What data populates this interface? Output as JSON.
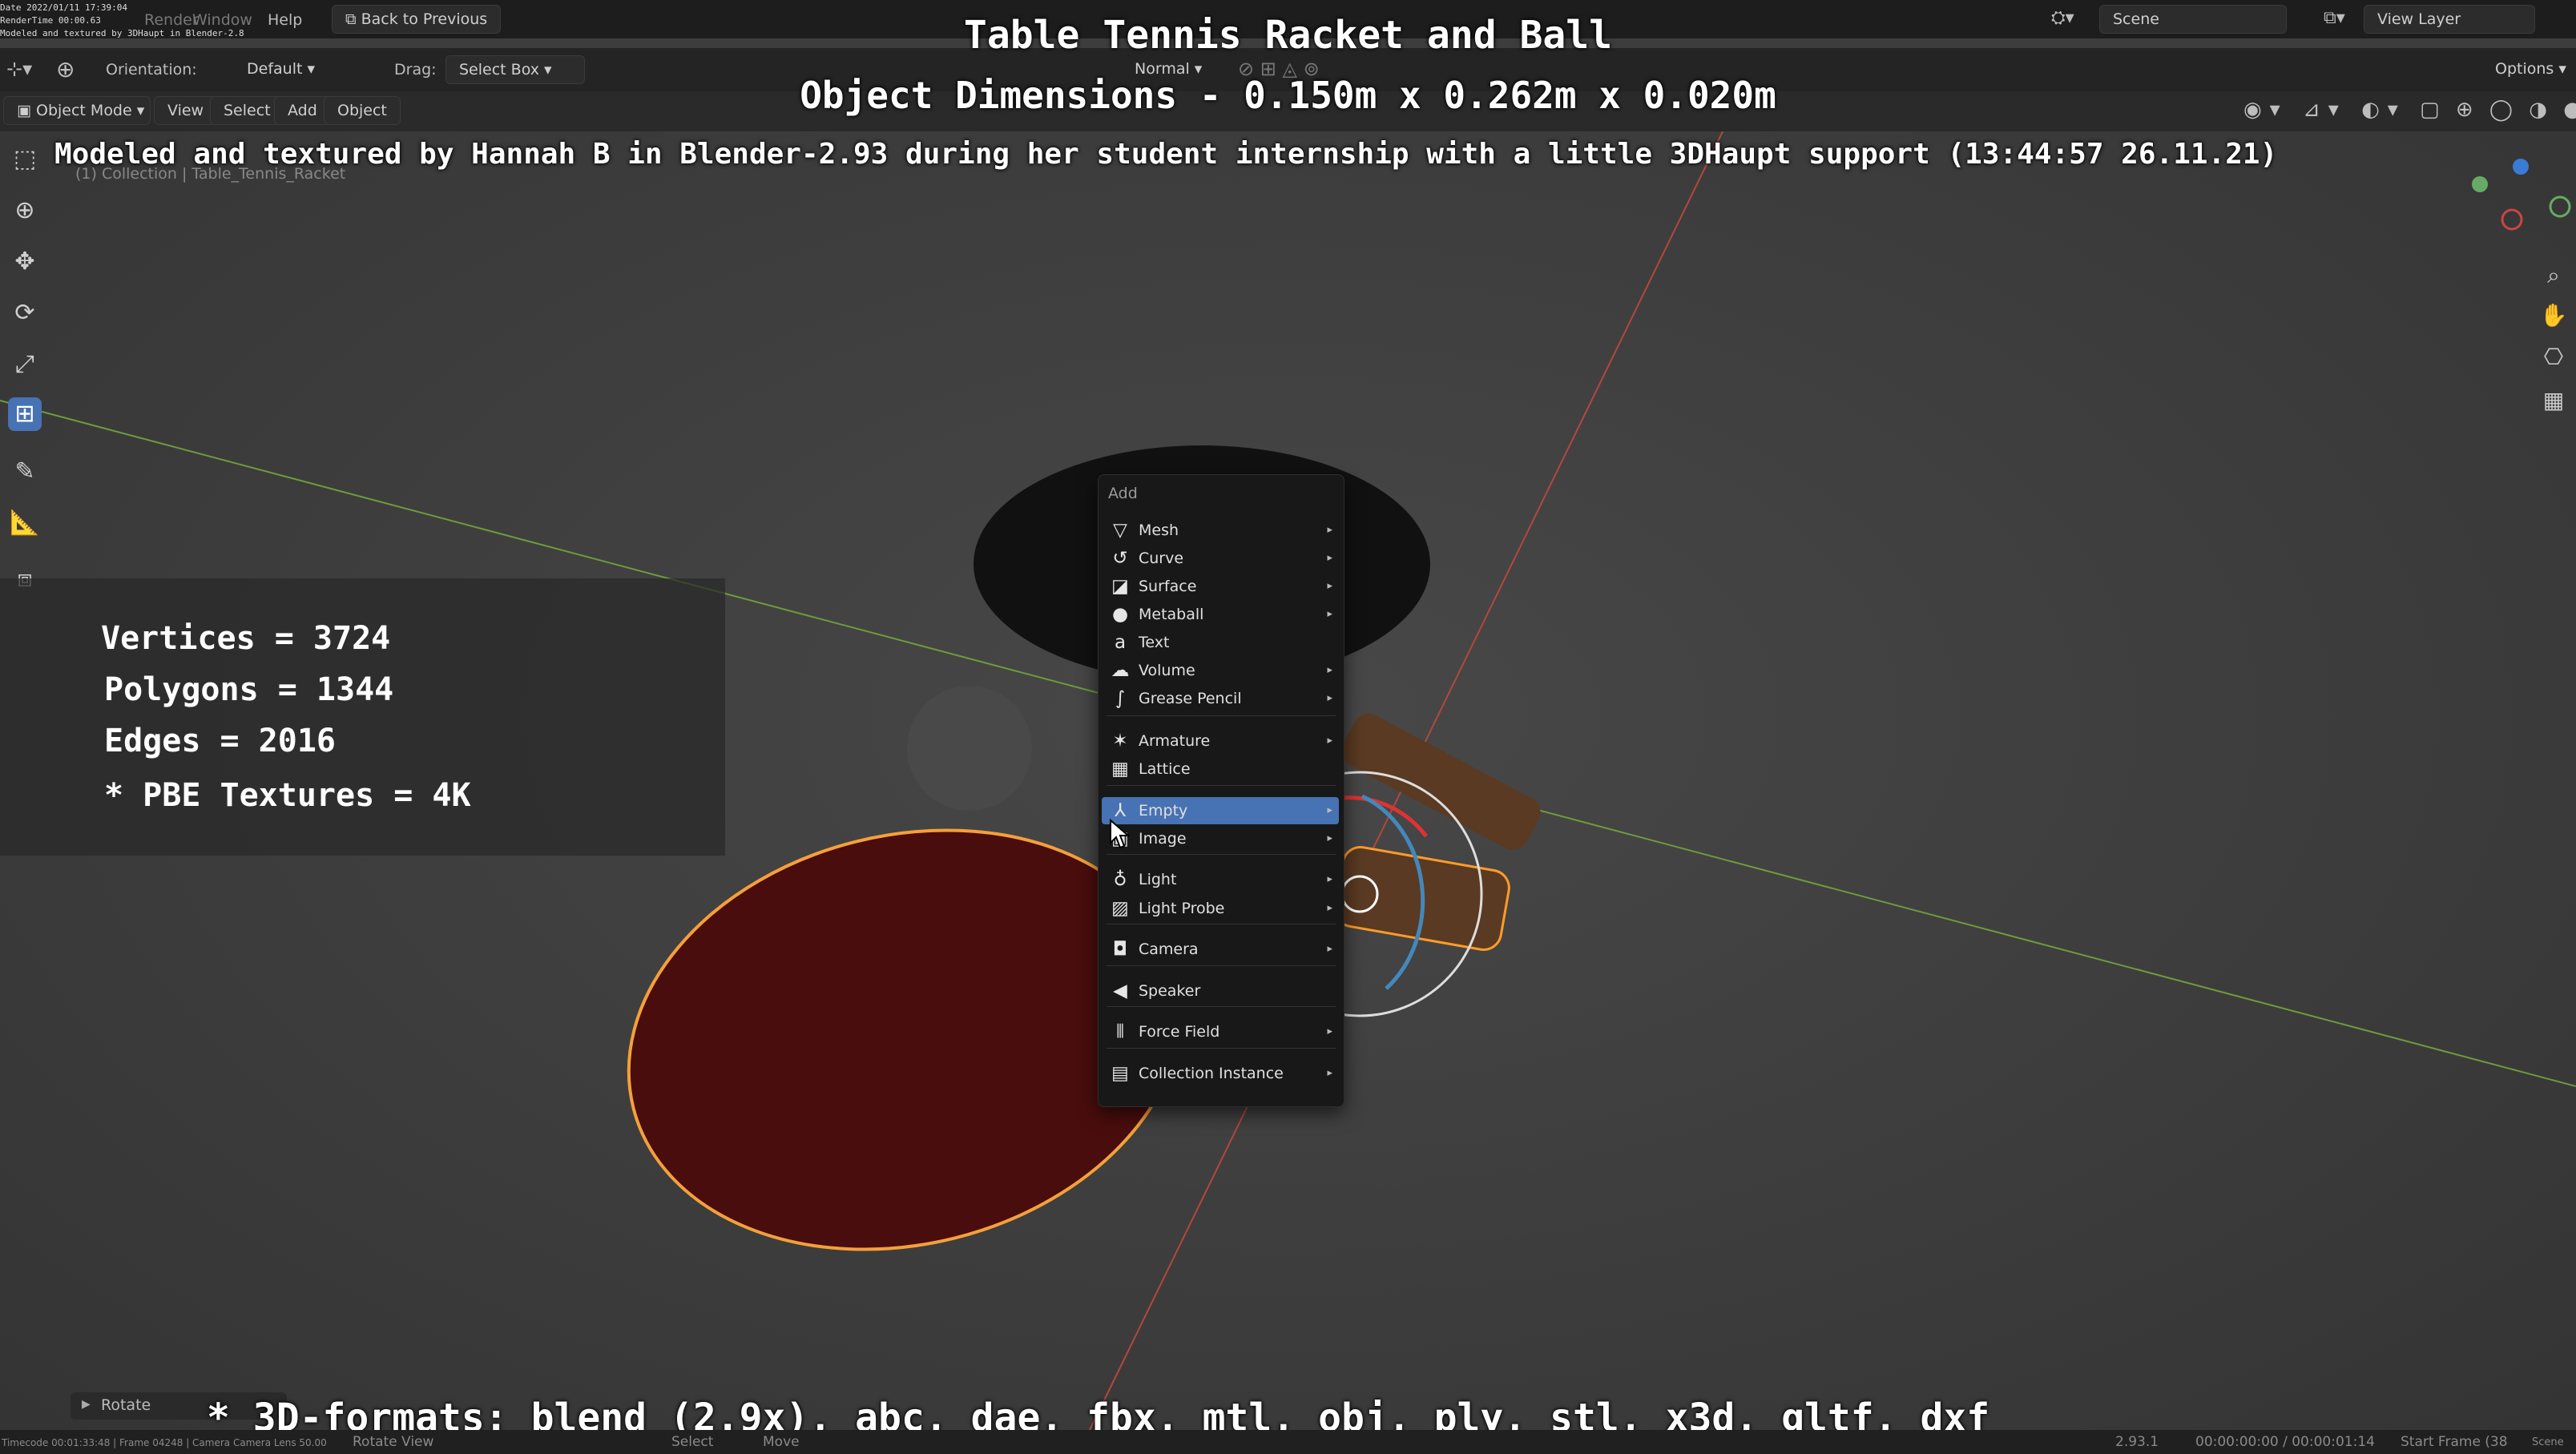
{
  "overlay": {
    "title": "Table Tennis Racket and Ball",
    "dimensions": "Object Dimensions -  0.150m x 0.262m x 0.020m",
    "credit": "Modeled and textured by Hannah B in Blender-2.93 during her student internship with a little 3DHaupt support (13:44:57 26.11.21)",
    "stats": {
      "vertices": "Vertices = 3724",
      "polygons": "Polygons = 1344",
      "edges": "Edges = 2016",
      "textures": "* PBE Textures = 4K"
    },
    "formats": "* 3D-formats: blend (2.9x), abc, dae, fbx, mtl, obj, ply, stl, x3d, gltf, dxf",
    "render_stamp": {
      "date": "Date 2022/01/11 17:39:04",
      "rendertime": "RenderTime 00:00.63",
      "note": "Modeled and textured by 3DHaupt in Blender-2.8"
    }
  },
  "topbar": {
    "menus": [
      "Render",
      "Window",
      "Help"
    ],
    "back_button": "Back to Previous",
    "scene_label": "Scene",
    "view_layer_label": "View Layer"
  },
  "header": {
    "orientation_label": "Orientation:",
    "orientation_value": "Default",
    "drag_label": "Drag:",
    "drag_value": "Select Box",
    "pivot_value": "Normal",
    "options": "Options"
  },
  "viewport_header": {
    "mode": "Object Mode",
    "menus": [
      "View",
      "Select",
      "Add",
      "Object"
    ]
  },
  "viewport_info": {
    "collection": "(1) Collection | Table_Tennis_Racket"
  },
  "add_menu": {
    "title": "Add",
    "items": [
      {
        "label": "Mesh",
        "icon": "mesh-icon",
        "glyph": "▽",
        "submenu": true
      },
      {
        "label": "Curve",
        "icon": "curve-icon",
        "glyph": "↺",
        "submenu": true
      },
      {
        "label": "Surface",
        "icon": "surface-icon",
        "glyph": "◪",
        "submenu": true
      },
      {
        "label": "Metaball",
        "icon": "metaball-icon",
        "glyph": "●",
        "submenu": true
      },
      {
        "label": "Text",
        "icon": "text-icon",
        "glyph": "a",
        "submenu": false
      },
      {
        "label": "Volume",
        "icon": "volume-icon",
        "glyph": "☁",
        "submenu": true
      },
      {
        "label": "Grease Pencil",
        "icon": "grease-pencil-icon",
        "glyph": "∫",
        "submenu": true
      },
      {
        "label": "Armature",
        "icon": "armature-icon",
        "glyph": "✶",
        "submenu": true
      },
      {
        "label": "Lattice",
        "icon": "lattice-icon",
        "glyph": "▦",
        "submenu": false
      },
      {
        "label": "Empty",
        "icon": "empty-icon",
        "glyph": "⅄",
        "submenu": true,
        "selected": true
      },
      {
        "label": "Image",
        "icon": "image-icon",
        "glyph": "▣",
        "submenu": true
      },
      {
        "label": "Light",
        "icon": "light-icon",
        "glyph": "♁",
        "submenu": true
      },
      {
        "label": "Light Probe",
        "icon": "light-probe-icon",
        "glyph": "▨",
        "submenu": true
      },
      {
        "label": "Camera",
        "icon": "camera-icon",
        "glyph": "◘",
        "submenu": true
      },
      {
        "label": "Speaker",
        "icon": "speaker-icon",
        "glyph": "◀",
        "submenu": false
      },
      {
        "label": "Force Field",
        "icon": "force-field-icon",
        "glyph": "⦀",
        "submenu": true
      },
      {
        "label": "Collection Instance",
        "icon": "collection-instance-icon",
        "glyph": "▤",
        "submenu": true
      }
    ]
  },
  "last_operator": "Rotate",
  "status": {
    "select": "Select",
    "move": "Move",
    "rotate_view": "Rotate View",
    "version": "2.93.1",
    "timecode": "00:00:00:00 / 00:00:01:14",
    "start_frame": "Start Frame (38",
    "scene": "Scene",
    "camera_stamp": "Timecode 00:01:33:48 | Frame 04248 | Camera Camera   Lens 50.00"
  }
}
